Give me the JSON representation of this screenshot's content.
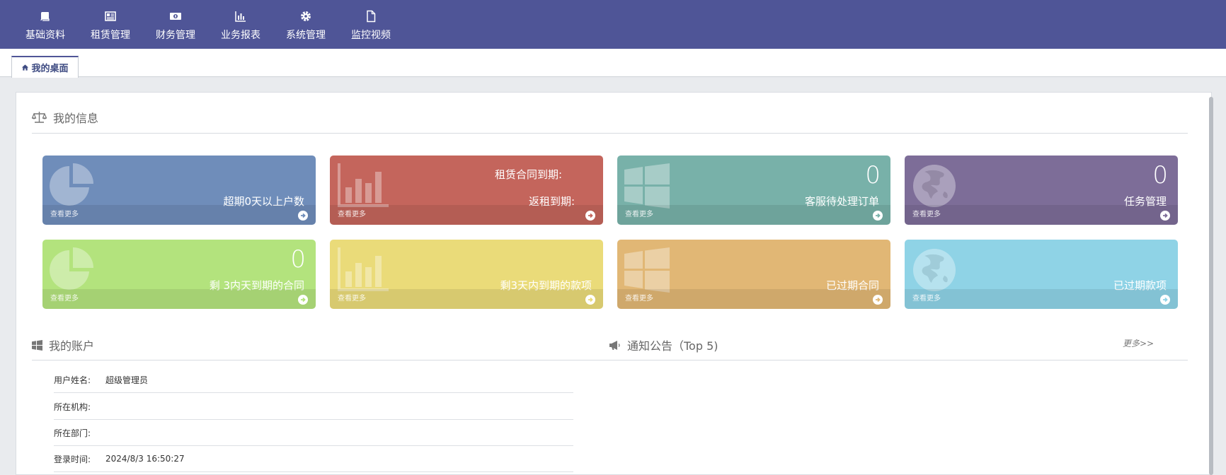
{
  "nav": [
    {
      "label": "基础资料",
      "icon": "book-icon"
    },
    {
      "label": "租赁管理",
      "icon": "newspaper-icon"
    },
    {
      "label": "财务管理",
      "icon": "money-icon"
    },
    {
      "label": "业务报表",
      "icon": "bar-chart-icon"
    },
    {
      "label": "系统管理",
      "icon": "gear-icon"
    },
    {
      "label": "监控视频",
      "icon": "file-icon"
    }
  ],
  "tab": {
    "label": "我的桌面",
    "icon": "home-icon"
  },
  "info_title": "我的信息",
  "more_label": "查看更多",
  "cards": [
    {
      "value": "",
      "label": "超期0天以上户数",
      "label2": "",
      "color": "#6f8dba",
      "icon": "pie-chart-icon"
    },
    {
      "value": "",
      "label": "返租到期:",
      "label2": "租赁合同到期:",
      "color": "#c4655c",
      "icon": "bar-chart-icon"
    },
    {
      "value": "0",
      "label": "客服待处理订单",
      "label2": "",
      "color": "#78b1a9",
      "icon": "windows-icon"
    },
    {
      "value": "0",
      "label": "任务管理",
      "label2": "",
      "color": "#7d6d98",
      "icon": "globe-icon"
    },
    {
      "value": "0",
      "label": "剩 3内天到期的合同",
      "label2": "",
      "color": "#b3e37d",
      "icon": "pie-chart-icon"
    },
    {
      "value": "",
      "label": "剩3天内到期的款项",
      "label2": "",
      "color": "#eadb79",
      "icon": "bar-chart-icon"
    },
    {
      "value": "",
      "label": "已过期合同",
      "label2": "",
      "color": "#e1b775",
      "icon": "windows-icon"
    },
    {
      "value": "",
      "label": "已过期款项",
      "label2": "",
      "color": "#8fd3e6",
      "icon": "globe-icon"
    }
  ],
  "account": {
    "title": "我的账户",
    "rows": [
      {
        "key": "用户姓名:",
        "value": "超级管理员"
      },
      {
        "key": "所在机构:",
        "value": ""
      },
      {
        "key": "所在部门:",
        "value": ""
      },
      {
        "key": "登录时间:",
        "value": "2024/8/3 16:50:27"
      }
    ]
  },
  "notice": {
    "title": "通知公告（Top 5)",
    "more": "更多>>"
  }
}
